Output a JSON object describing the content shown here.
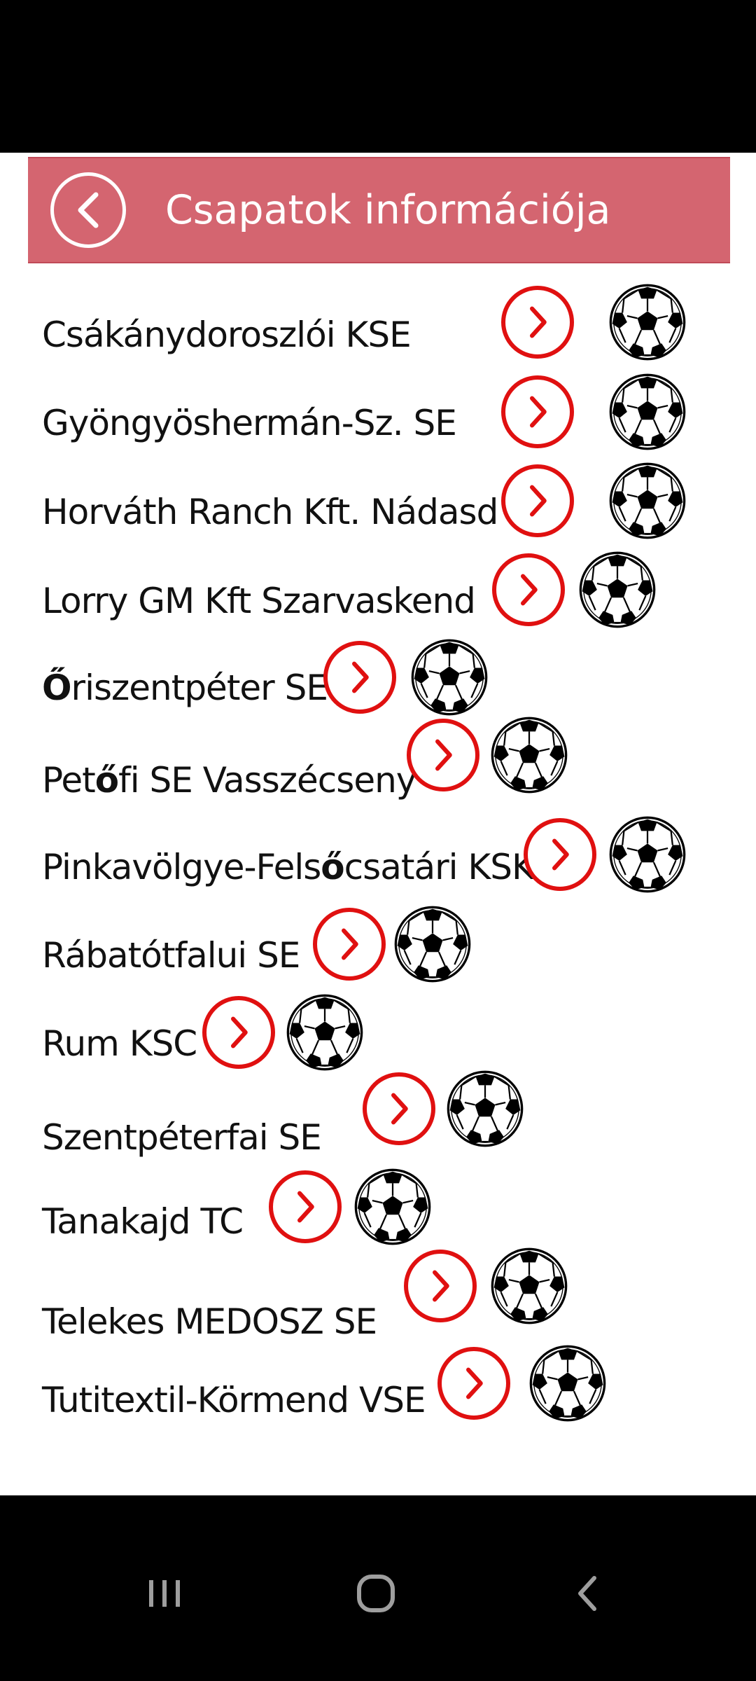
{
  "header": {
    "title": "Csapatok információja",
    "back_icon": "chevron-left-icon"
  },
  "teams": [
    {
      "prefix": "Csákánydoroszlói KSE",
      "bold": "",
      "suffix": ""
    },
    {
      "prefix": "Gyöngyöshermán-Sz. SE",
      "bold": "",
      "suffix": ""
    },
    {
      "prefix": "Horváth Ranch Kft. Nádasd",
      "bold": "",
      "suffix": ""
    },
    {
      "prefix": "Lorry GM Kft Szarvaskend",
      "bold": "",
      "suffix": ""
    },
    {
      "prefix": "",
      "bold": "Ő",
      "suffix": "riszentpéter SE"
    },
    {
      "prefix": "Pet",
      "bold": "ő",
      "suffix": "fi SE Vasszécseny"
    },
    {
      "prefix": "Pinkavölgye-Fels",
      "bold": "ő",
      "suffix": "csatári KSK"
    },
    {
      "prefix": "Rábatótfalui SE",
      "bold": "",
      "suffix": ""
    },
    {
      "prefix": "Rum KSC",
      "bold": "",
      "suffix": ""
    },
    {
      "prefix": "Szentpéterfai SE",
      "bold": "",
      "suffix": ""
    },
    {
      "prefix": "Tanakajd TC",
      "bold": "",
      "suffix": ""
    },
    {
      "prefix": "Telekes MEDOSZ SE",
      "bold": "",
      "suffix": ""
    },
    {
      "prefix": "Tutitextil-Körmend VSE",
      "bold": "",
      "suffix": ""
    }
  ],
  "icons": {
    "row_action": "chevron-right-circle-icon",
    "row_badge": "soccer-ball-icon"
  },
  "colors": {
    "header_bg": "#d46570",
    "accent_red": "#e01010"
  },
  "nav": {
    "recents": "recent-apps-icon",
    "home": "home-icon",
    "back": "back-icon"
  }
}
